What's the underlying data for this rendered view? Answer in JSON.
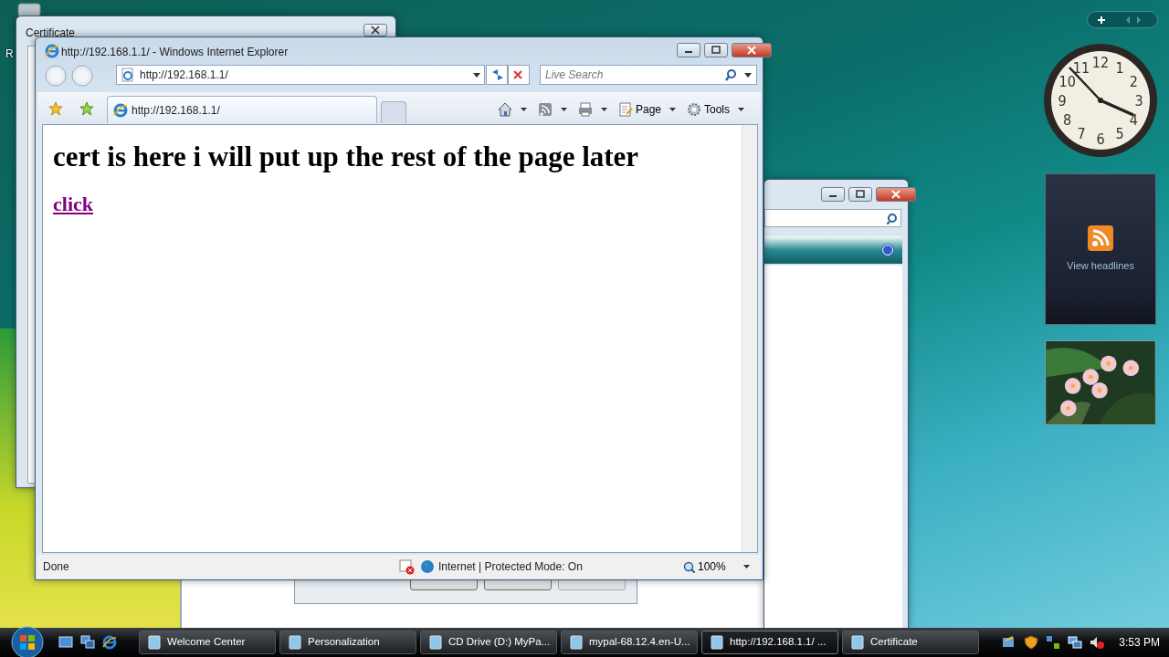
{
  "desktop_icon": {
    "label": "R"
  },
  "certificate_window": {
    "title": "Certificate"
  },
  "ie_window": {
    "title": "http://192.168.1.1/ - Windows Internet Explorer",
    "address": "http://192.168.1.1/",
    "search": {
      "placeholder": "Live Search"
    },
    "tabs": [
      {
        "label": "http://192.168.1.1/",
        "selected": true
      }
    ],
    "command_bar": [
      {
        "kind": "home"
      },
      {
        "kind": "feeds"
      },
      {
        "kind": "print"
      },
      {
        "kind": "page",
        "label": "Page"
      },
      {
        "kind": "tools",
        "label": "Tools"
      }
    ],
    "page": {
      "heading": "cert is here i will put up the rest of the page later",
      "link": "click"
    },
    "status_bar": {
      "text": "Done",
      "zone": "Internet | Protected Mode: On",
      "zoom": "100%"
    }
  },
  "gadgets": {
    "clock": {
      "numerals": [
        "12",
        "11",
        "1",
        "10",
        "2",
        "9",
        "3",
        "8",
        "4",
        "7",
        "5",
        "6"
      ]
    },
    "feed": {
      "label": "View headlines"
    }
  },
  "taskbar": {
    "buttons": [
      {
        "label": "Welcome Center",
        "selected": false
      },
      {
        "label": "Personalization",
        "selected": false
      },
      {
        "label": "CD Drive (D:) MyPa...",
        "selected": false
      },
      {
        "label": "mypal-68.12.4.en-U...",
        "selected": false
      },
      {
        "label": "http://192.168.1.1/ ...",
        "selected": true
      },
      {
        "label": "Certificate",
        "selected": false
      }
    ],
    "time": "3:53 PM"
  }
}
